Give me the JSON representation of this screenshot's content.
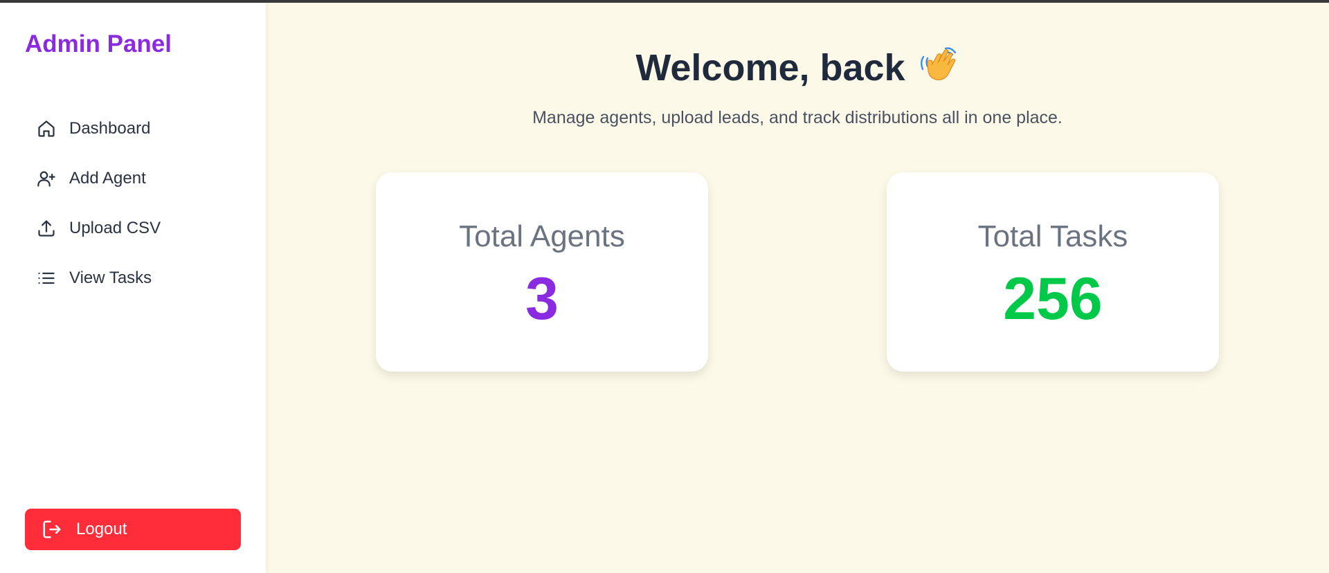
{
  "sidebar": {
    "brand": "Admin Panel",
    "items": [
      {
        "label": "Dashboard",
        "icon": "home-icon"
      },
      {
        "label": "Add Agent",
        "icon": "user-plus-icon"
      },
      {
        "label": "Upload CSV",
        "icon": "upload-icon"
      },
      {
        "label": "View Tasks",
        "icon": "list-icon"
      }
    ],
    "logout_label": "Logout"
  },
  "main": {
    "welcome": "Welcome, back",
    "wave_icon": "waving-hand-icon",
    "subtitle": "Manage agents, upload leads, and track distributions all in one place.",
    "cards": [
      {
        "title": "Total Agents",
        "value": "3",
        "color": "#8a2be2"
      },
      {
        "title": "Total Tasks",
        "value": "256",
        "color": "#00c94a"
      }
    ]
  },
  "colors": {
    "brand": "#8a2be2",
    "logout": "#ff2d3a",
    "background": "#fdf9e9"
  }
}
